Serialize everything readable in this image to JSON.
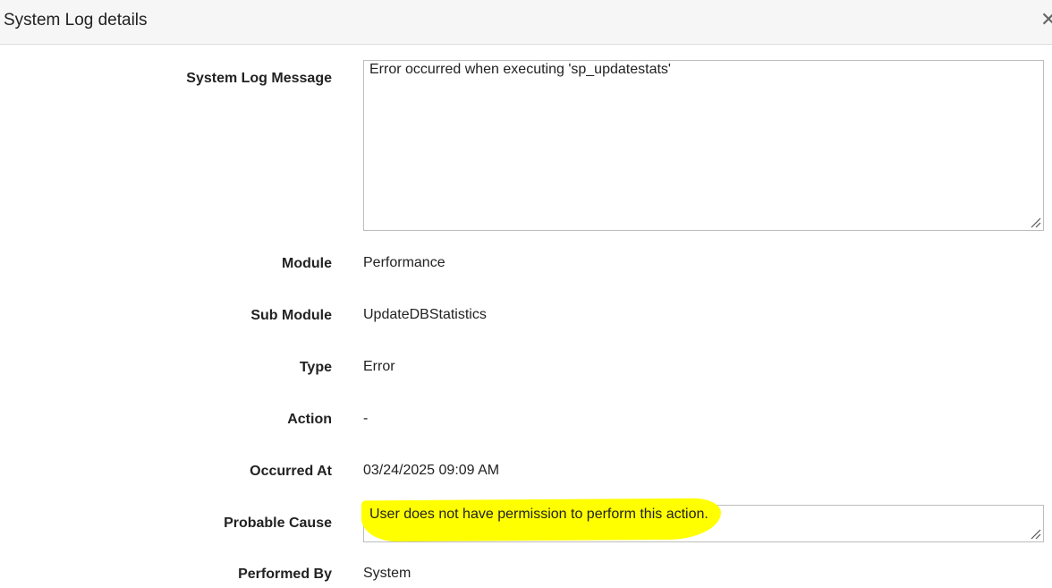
{
  "dialog": {
    "title": "System Log details"
  },
  "fields": {
    "message_label": "System Log Message",
    "message_value": "Error occurred when executing 'sp_updatestats'",
    "module_label": "Module",
    "module_value": "Performance",
    "submodule_label": "Sub Module",
    "submodule_value": "UpdateDBStatistics",
    "type_label": "Type",
    "type_value": "Error",
    "action_label": "Action",
    "action_value": "-",
    "occurred_label": "Occurred At",
    "occurred_value": "03/24/2025 09:09 AM",
    "cause_label": "Probable Cause",
    "cause_value": "User does not have permission to perform this action.",
    "performed_label": "Performed By",
    "performed_value": "System"
  },
  "icons": {
    "close": "close-icon",
    "resize": "resize-grip-icon"
  },
  "colors": {
    "header_bg": "#f6f6f6",
    "highlight": "#ffff00",
    "border": "#bdbdbd"
  }
}
